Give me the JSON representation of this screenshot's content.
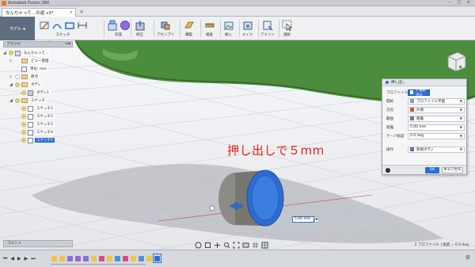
{
  "window": {
    "app_title": "Autodesk Fusion 360"
  },
  "tab": {
    "file_name": "なんちゃって…の遊 v3*",
    "close_glyph": "×"
  },
  "toolbar": {
    "workspace_label": "モデル",
    "groups": [
      {
        "label": "スケッチ"
      },
      {
        "label": "作成"
      },
      {
        "label": "修正"
      },
      {
        "label": "アセンブリ"
      },
      {
        "label": "構築"
      },
      {
        "label": "検査"
      },
      {
        "label": "挿入"
      },
      {
        "label": "メイク"
      },
      {
        "label": "アドイン"
      },
      {
        "label": "選択"
      }
    ]
  },
  "browser": {
    "header": "ブラウザ",
    "items": [
      {
        "label": "なんちゃって…",
        "level": 0,
        "selected": false
      },
      {
        "label": "ビュー管理",
        "level": 1,
        "selected": false
      },
      {
        "label": "単位: mm",
        "level": 1,
        "selected": false
      },
      {
        "label": "原点",
        "level": 1,
        "selected": false
      },
      {
        "label": "ボディ",
        "level": 1,
        "selected": false
      },
      {
        "label": "ボディ1",
        "level": 2,
        "selected": false
      },
      {
        "label": "スケッチ",
        "level": 1,
        "selected": false
      },
      {
        "label": "スケッチ1",
        "level": 2,
        "selected": false
      },
      {
        "label": "スケッチ2",
        "level": 2,
        "selected": false
      },
      {
        "label": "スケッチ3",
        "level": 2,
        "selected": false
      },
      {
        "label": "スケッチ4",
        "level": 2,
        "selected": false
      },
      {
        "label": "スケッチ5",
        "level": 2,
        "selected": true
      }
    ]
  },
  "annotation": {
    "text": "押し出しで５mm",
    "color": "#e3241b"
  },
  "dialog": {
    "title": "押し出し",
    "rows": [
      {
        "key": "プロファイル",
        "value": "1 選択済み",
        "style": "selected"
      },
      {
        "key": "開始",
        "value": "プロファイル平面",
        "style": "dropdown"
      },
      {
        "key": "方向",
        "value": "片側",
        "style": "dropdown"
      },
      {
        "key": "範囲",
        "value": "距離",
        "style": "dropdown"
      },
      {
        "key": "距離",
        "value": "5.00 mm",
        "style": "dropdown"
      },
      {
        "key": "テーパ角度",
        "value": "0.0 deg",
        "style": "dropdown"
      },
      {
        "key": "操作",
        "value": "新規ボディ",
        "style": "dropdown"
      }
    ],
    "ok": "OK",
    "cancel": "キャンセル"
  },
  "distance_input": {
    "value": "5.00 mm"
  },
  "comment_bar": {
    "label": "コメント"
  },
  "status": {
    "text": "2 プロファイル | 角度 = 0.0 deg"
  },
  "timeline": {
    "controls": [
      "⏮",
      "◀",
      "▶",
      "▶",
      "⏭"
    ],
    "items": [
      {
        "color": "#f0c34a"
      },
      {
        "color": "#f0c34a"
      },
      {
        "color": "#8d6fd6"
      },
      {
        "color": "#8d6fd6"
      },
      {
        "color": "#8d6fd6"
      },
      {
        "color": "#f0c34a"
      },
      {
        "color": "#d24b86"
      },
      {
        "color": "#f0c34a"
      },
      {
        "color": "#4d8fd9"
      },
      {
        "color": "#d24b86"
      },
      {
        "color": "#f0c34a"
      },
      {
        "color": "#4d8fd9"
      },
      {
        "color": "#f0c34a"
      },
      {
        "color": "#2d6fd1"
      }
    ]
  },
  "colors": {
    "accent": "#2d6fd1",
    "model_green": "#4c8c3d",
    "extrude_blue": "#2f6cd0"
  }
}
